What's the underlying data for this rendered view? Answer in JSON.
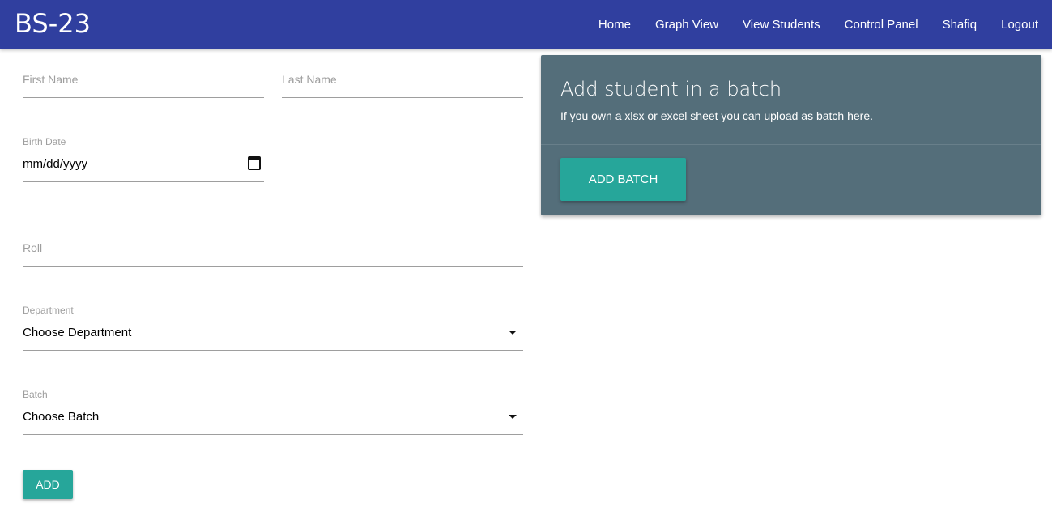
{
  "brand": "BS-23",
  "nav": {
    "items": [
      "Home",
      "Graph View",
      "View Students",
      "Control Panel",
      "Shafiq",
      "Logout"
    ]
  },
  "form": {
    "first_name_placeholder": "First Name",
    "last_name_placeholder": "Last Name",
    "birth_date_label": "Birth Date",
    "birth_date_value": "mm/dd/yyyy",
    "roll_placeholder": "Roll",
    "department_label": "Department",
    "department_value": "Choose Department",
    "batch_label": "Batch",
    "batch_value": "Choose Batch",
    "add_label": "ADD"
  },
  "card": {
    "title": "Add student in a batch",
    "text": "If you own a xlsx or excel sheet you can upload as batch here.",
    "button_label": "ADD BATCH"
  },
  "colors": {
    "navbar": "#303f9f",
    "card": "#546e7a",
    "accent": "#26a69a"
  },
  "icons": {
    "birth_date": "calendar-icon",
    "dropdown": "dropdown-caret-icon"
  }
}
